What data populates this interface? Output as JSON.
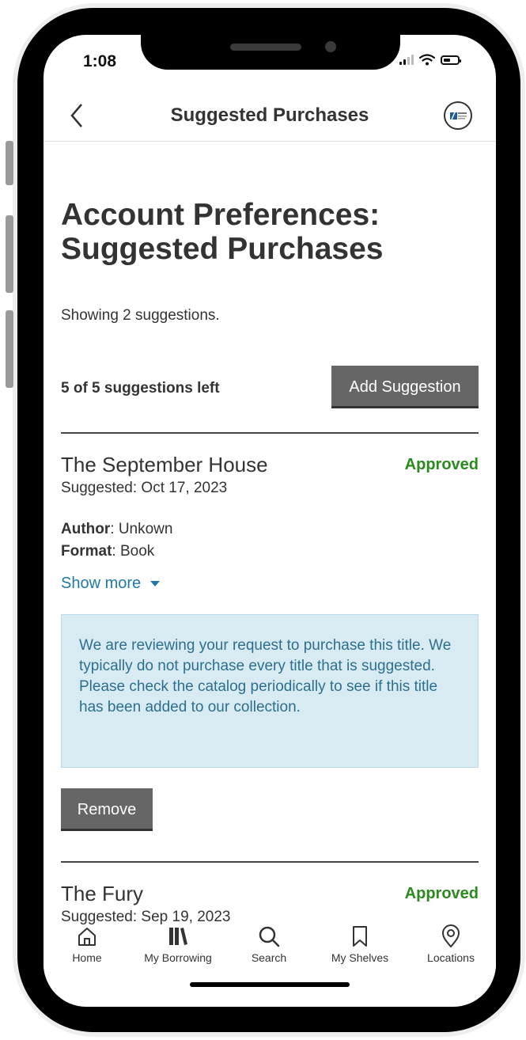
{
  "status_bar": {
    "time": "1:08"
  },
  "nav": {
    "title": "Suggested Purchases",
    "back_icon": "chevron-left-icon",
    "avatar_icon": "library-logo-icon"
  },
  "page": {
    "title_line1": "Account Preferences:",
    "title_line2": "Suggested Purchases",
    "showing_text": "Showing 2 suggestions.",
    "suggestions_left": "5 of 5 suggestions left",
    "add_button": "Add Suggestion"
  },
  "suggestions": [
    {
      "title": "The September House",
      "status": "Approved",
      "suggested": "Suggested: Oct 17, 2023",
      "author_label": "Author",
      "author_value": ": Unkown",
      "format_label": "Format",
      "format_value": ": Book",
      "show_more": "Show more",
      "notice": "We are reviewing your request to purchase this title. We typically do not purchase every title that is suggested. Please check the catalog periodically to see if this title has been added to our collection.",
      "remove_button": "Remove"
    },
    {
      "title": "The Fury",
      "status": "Approved",
      "suggested": "Suggested: Sep 19, 2023"
    }
  ],
  "tabs": [
    {
      "label": "Home",
      "icon": "home-icon"
    },
    {
      "label": "My Borrowing",
      "icon": "books-icon"
    },
    {
      "label": "Search",
      "icon": "search-icon"
    },
    {
      "label": "My Shelves",
      "icon": "bookmark-icon"
    },
    {
      "label": "Locations",
      "icon": "location-pin-icon"
    }
  ],
  "colors": {
    "approved": "#2a8a1e",
    "link": "#1f7aa6",
    "notice_bg": "#d8ebf3",
    "button": "#666666"
  }
}
